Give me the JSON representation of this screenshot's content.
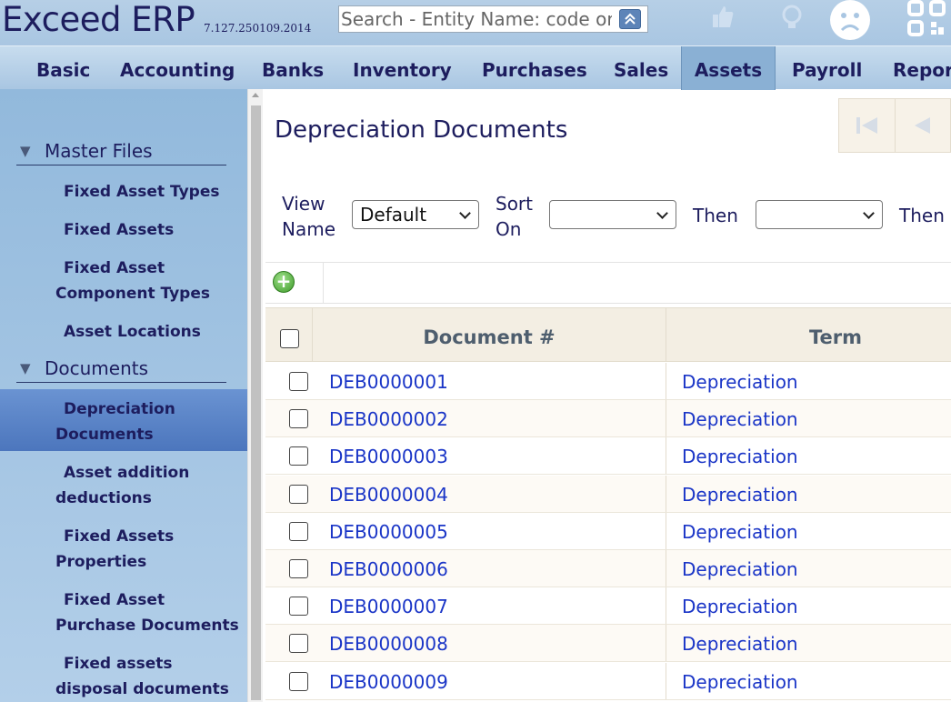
{
  "app": {
    "title": "Exceed ERP",
    "version": "7.127.250109.2014"
  },
  "search": {
    "placeholder": "Search - Entity Name: code or name"
  },
  "icons": {
    "search_toggle": "chevron-up-icon",
    "thumbs_up": "thumbs-up-icon",
    "lightbulb": "lightbulb-icon",
    "feedback": "sad-face-icon",
    "qr": "qr-code-icon",
    "add": "plus-circle-icon",
    "pager_first": "first-page-icon",
    "pager_prev": "previous-page-icon"
  },
  "nav": {
    "items": [
      "Basic",
      "Accounting",
      "Banks",
      "Inventory",
      "Purchases",
      "Sales",
      "Assets",
      "Payroll",
      "Repor"
    ],
    "active": "Assets"
  },
  "sidebar": {
    "sections": [
      {
        "label": "Master Files",
        "items": [
          [
            "Fixed Asset Types"
          ],
          [
            "Fixed Assets"
          ],
          [
            "Fixed Asset",
            "Component Types"
          ],
          [
            "Asset Locations"
          ]
        ]
      },
      {
        "label": "Documents",
        "items": [
          [
            "Depreciation",
            "Documents"
          ],
          [
            "Asset addition",
            "deductions"
          ],
          [
            "Fixed Assets",
            "Properties"
          ],
          [
            "Fixed Asset",
            "Purchase Documents"
          ],
          [
            "Fixed assets",
            "disposal documents"
          ]
        ]
      }
    ],
    "active_item": "Depreciation Documents"
  },
  "main": {
    "title": "Depreciation Documents",
    "filters": {
      "view_name_label": [
        "View",
        "Name"
      ],
      "view_name_value": "Default",
      "sort_on_label": [
        "Sort",
        "On"
      ],
      "sort_on_value": "",
      "then_label": "Then",
      "then_value": "",
      "then2_label": "Then"
    },
    "grid": {
      "columns": [
        "Document #",
        "Term"
      ],
      "rows": [
        {
          "doc": "DEB0000001",
          "term": "Depreciation"
        },
        {
          "doc": "DEB0000002",
          "term": "Depreciation"
        },
        {
          "doc": "DEB0000003",
          "term": "Depreciation"
        },
        {
          "doc": "DEB0000004",
          "term": "Depreciation"
        },
        {
          "doc": "DEB0000005",
          "term": "Depreciation"
        },
        {
          "doc": "DEB0000006",
          "term": "Depreciation"
        },
        {
          "doc": "DEB0000007",
          "term": "Depreciation"
        },
        {
          "doc": "DEB0000008",
          "term": "Depreciation"
        },
        {
          "doc": "DEB0000009",
          "term": "Depreciation"
        }
      ]
    }
  },
  "colors": {
    "topbar": "#a9c6e2",
    "text_dark": "#1d1d5e",
    "link": "#1a35c7",
    "active_side": "#4c76bd"
  }
}
